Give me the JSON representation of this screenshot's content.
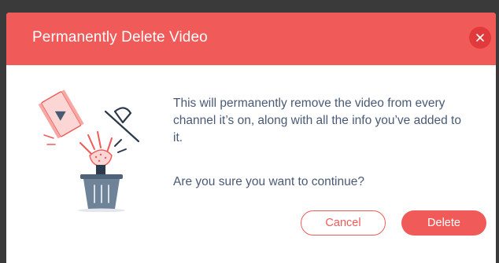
{
  "dialog": {
    "title": "Permanently Delete Video",
    "message": "This will permanently remove the video from every channel it’s on, along with all the info you’ve added to it.",
    "question": "Are you sure you want to continue?",
    "cancel_label": "Cancel",
    "delete_label": "Delete",
    "close_icon": "close-icon",
    "illustration": "trash-delete-video-icon"
  },
  "colors": {
    "accent": "#f05a58",
    "close_bg": "#e13a3d",
    "body_text": "#4a5a75",
    "trash": "#6e8298"
  }
}
